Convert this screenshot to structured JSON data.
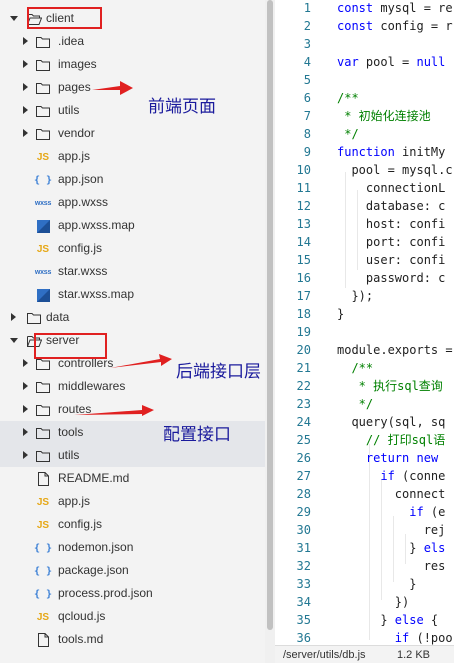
{
  "tree": [
    {
      "label": "client",
      "kind": "folder-open",
      "depth": 0,
      "expanded": true
    },
    {
      "label": ".idea",
      "kind": "folder",
      "depth": 1,
      "expandable": true
    },
    {
      "label": "images",
      "kind": "folder",
      "depth": 1,
      "expandable": true
    },
    {
      "label": "pages",
      "kind": "folder",
      "depth": 1,
      "expandable": true
    },
    {
      "label": "utils",
      "kind": "folder",
      "depth": 1,
      "expandable": true
    },
    {
      "label": "vendor",
      "kind": "folder",
      "depth": 1,
      "expandable": true
    },
    {
      "label": "app.js",
      "kind": "js",
      "depth": 1
    },
    {
      "label": "app.json",
      "kind": "json",
      "depth": 1
    },
    {
      "label": "app.wxss",
      "kind": "wxss",
      "depth": 1
    },
    {
      "label": "app.wxss.map",
      "kind": "map",
      "depth": 1
    },
    {
      "label": "config.js",
      "kind": "js",
      "depth": 1
    },
    {
      "label": "star.wxss",
      "kind": "wxss",
      "depth": 1
    },
    {
      "label": "star.wxss.map",
      "kind": "map",
      "depth": 1
    },
    {
      "label": "data",
      "kind": "folder",
      "depth": 0,
      "expandable": true
    },
    {
      "label": "server",
      "kind": "folder-open",
      "depth": 0,
      "expanded": true
    },
    {
      "label": "controllers",
      "kind": "folder",
      "depth": 1,
      "expandable": true
    },
    {
      "label": "middlewares",
      "kind": "folder",
      "depth": 1,
      "expandable": true
    },
    {
      "label": "routes",
      "kind": "folder",
      "depth": 1,
      "expandable": true
    },
    {
      "label": "tools",
      "kind": "folder",
      "depth": 1,
      "expandable": true,
      "highlight": true
    },
    {
      "label": "utils",
      "kind": "folder",
      "depth": 1,
      "expandable": true,
      "highlight": true
    },
    {
      "label": "README.md",
      "kind": "file",
      "depth": 1
    },
    {
      "label": "app.js",
      "kind": "js",
      "depth": 1
    },
    {
      "label": "config.js",
      "kind": "js",
      "depth": 1
    },
    {
      "label": "nodemon.json",
      "kind": "json",
      "depth": 1
    },
    {
      "label": "package.json",
      "kind": "json",
      "depth": 1
    },
    {
      "label": "process.prod.json",
      "kind": "json",
      "depth": 1
    },
    {
      "label": "qcloud.js",
      "kind": "js",
      "depth": 1
    },
    {
      "label": "tools.md",
      "kind": "file",
      "depth": 1
    }
  ],
  "icons": {
    "js": "JS",
    "json": "{ }",
    "wxss": "wxss"
  },
  "annotations": {
    "front": "前端页面",
    "back": "后端接口层",
    "config": "配置接口"
  },
  "code": {
    "lines": [
      {
        "n": "1",
        "t": "const mysql = re",
        "k": [
          [
            "const",
            0
          ]
        ]
      },
      {
        "n": "2",
        "t": "const config = r",
        "k": [
          [
            "const",
            0
          ]
        ]
      },
      {
        "n": "3",
        "t": ""
      },
      {
        "n": "4",
        "t": "var pool = null",
        "k": [
          [
            "var",
            0
          ],
          [
            "null",
            11
          ]
        ]
      },
      {
        "n": "5",
        "t": ""
      },
      {
        "n": "6",
        "t": "/**",
        "c": true
      },
      {
        "n": "7",
        "t": " * 初始化连接池",
        "c": true
      },
      {
        "n": "8",
        "t": " */",
        "c": true
      },
      {
        "n": "9",
        "t": "function initMy",
        "k": [
          [
            "function",
            0
          ]
        ]
      },
      {
        "n": "10",
        "t": "  pool = mysql.c"
      },
      {
        "n": "11",
        "t": "    connectionL"
      },
      {
        "n": "12",
        "t": "    database: c"
      },
      {
        "n": "13",
        "t": "    host: confi"
      },
      {
        "n": "14",
        "t": "    port: confi"
      },
      {
        "n": "15",
        "t": "    user: confi"
      },
      {
        "n": "16",
        "t": "    password: c"
      },
      {
        "n": "17",
        "t": "  });"
      },
      {
        "n": "18",
        "t": "}"
      },
      {
        "n": "19",
        "t": ""
      },
      {
        "n": "20",
        "t": "module.exports ="
      },
      {
        "n": "21",
        "t": "  /**",
        "c": true
      },
      {
        "n": "22",
        "t": "   * 执行sql查询",
        "c": true
      },
      {
        "n": "23",
        "t": "   */",
        "c": true
      },
      {
        "n": "24",
        "t": "  query(sql, sq"
      },
      {
        "n": "25",
        "t": "    // 打印sql语",
        "c": true
      },
      {
        "n": "26",
        "t": "    return new ",
        "k": [
          [
            "return",
            4
          ],
          [
            "new",
            11
          ]
        ]
      },
      {
        "n": "27",
        "t": "      if (conne",
        "k": [
          [
            "if",
            6
          ]
        ]
      },
      {
        "n": "28",
        "t": "        connect"
      },
      {
        "n": "29",
        "t": "          if (e",
        "k": [
          [
            "if",
            10
          ]
        ]
      },
      {
        "n": "30",
        "t": "            rej"
      },
      {
        "n": "31",
        "t": "          } els",
        "k": [
          [
            "els",
            12
          ]
        ]
      },
      {
        "n": "32",
        "t": "            res"
      },
      {
        "n": "33",
        "t": "          }"
      },
      {
        "n": "34",
        "t": "        })"
      },
      {
        "n": "35",
        "t": "      } else {",
        "k": [
          [
            "else",
            8
          ]
        ]
      },
      {
        "n": "36",
        "t": "        if (!poo",
        "k": [
          [
            "if",
            8
          ]
        ]
      }
    ]
  },
  "status": {
    "path": "/server/utils/db.js",
    "size": "1.2 KB"
  }
}
